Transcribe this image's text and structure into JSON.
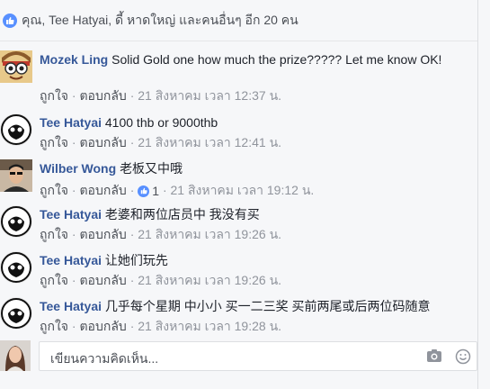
{
  "likes": {
    "text": "คุณ, Tee Hatyai, ดี้ หาดใหญ่ และคนอื่นๆ อีก 20 คน",
    "icon": "thumbs-up-icon"
  },
  "actions": {
    "like": "ถูกใจ",
    "reply": "ตอบกลับ",
    "separator": "·"
  },
  "comments": [
    {
      "author": "Mozek Ling",
      "text": "Solid Gold one how much the prize????? Let me know OK!",
      "timestamp": "21 สิงหาคม เวลา 12:37 น.",
      "avatar": "cartoon-avatar"
    },
    {
      "author": "Tee Hatyai",
      "text": "4100 thb or 9000thb",
      "timestamp": "21 สิงหาคม เวลา 12:41 น.",
      "avatar": "skull-avatar"
    },
    {
      "author": "Wilber Wong",
      "text": "老板又中哦",
      "timestamp": "21 สิงหาคม เวลา 19:12 น.",
      "reaction_count": "1",
      "avatar": "photo-avatar"
    },
    {
      "author": "Tee Hatyai",
      "text": "老婆和两位店员中 我没有买",
      "timestamp": "21 สิงหาคม เวลา 19:26 น.",
      "avatar": "skull-avatar"
    },
    {
      "author": "Tee Hatyai",
      "text": "让她们玩先",
      "timestamp": "21 สิงหาคม เวลา 19:26 น.",
      "avatar": "skull-avatar"
    },
    {
      "author": "Tee Hatyai",
      "text": "几乎每个星期 中小小 买一二三奖 买前两尾或后两位码随意",
      "timestamp": "21 สิงหาคม เวลา 19:28 น.",
      "avatar": "skull-avatar"
    }
  ],
  "composer": {
    "placeholder": "เขียนความคิดเห็น...",
    "camera_icon": "camera-icon",
    "emoji_icon": "emoji-icon"
  },
  "colors": {
    "author": "#365899",
    "meta": "#90949c",
    "like_blue": "#5890ff",
    "background": "#f6f7f9"
  }
}
